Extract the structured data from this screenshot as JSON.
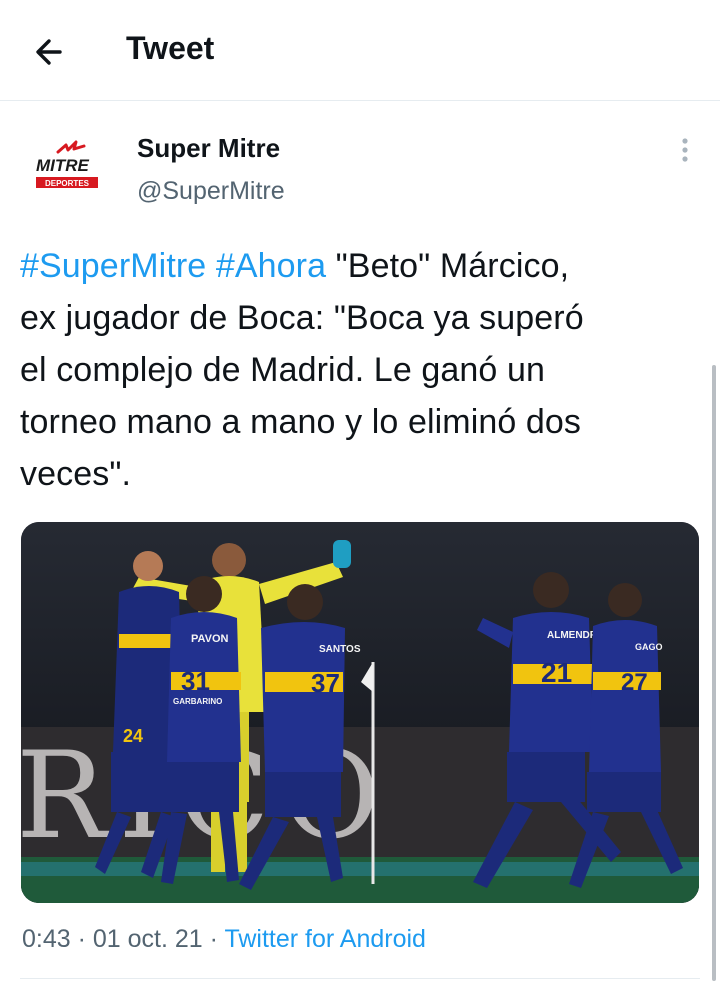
{
  "header": {
    "title": "Tweet",
    "back_icon": "arrow-left-icon"
  },
  "author": {
    "avatar_icon": "mitre-deportes-logo",
    "logo_text_top": "MITRE",
    "logo_text_bottom": "DEPORTES",
    "name": "Super Mitre",
    "handle": "@SuperMitre"
  },
  "tweet": {
    "hashtag1": "#SuperMitre",
    "hashtag2": "#Ahora",
    "line1_rest": "\"Beto\" Márcico,",
    "line2": "ex jugador de Boca: \"Boca ya superó",
    "line3": "el complejo de Madrid. Le ganó un",
    "line4": "torneo mano a mano y lo eliminó dos",
    "line5": "veces\"."
  },
  "meta": {
    "time": "0:43",
    "sep1": " · ",
    "date": "01 oct. 21",
    "sep2": " · ",
    "source": "Twitter for Android"
  },
  "colors": {
    "link": "#1d9bf0",
    "secondary": "#536471",
    "divider": "#e6ecf0",
    "brand_red": "#d71920"
  },
  "photo": {
    "icon": "football-celebration-photo",
    "jersey_names": [
      "PAVON",
      "SANTOS",
      "ALMENDRA",
      "GAGO"
    ],
    "jersey_numbers": [
      "31",
      "37",
      "24",
      "21",
      "27"
    ],
    "sponsor": "GARBARINO",
    "board_text": "RICO"
  }
}
